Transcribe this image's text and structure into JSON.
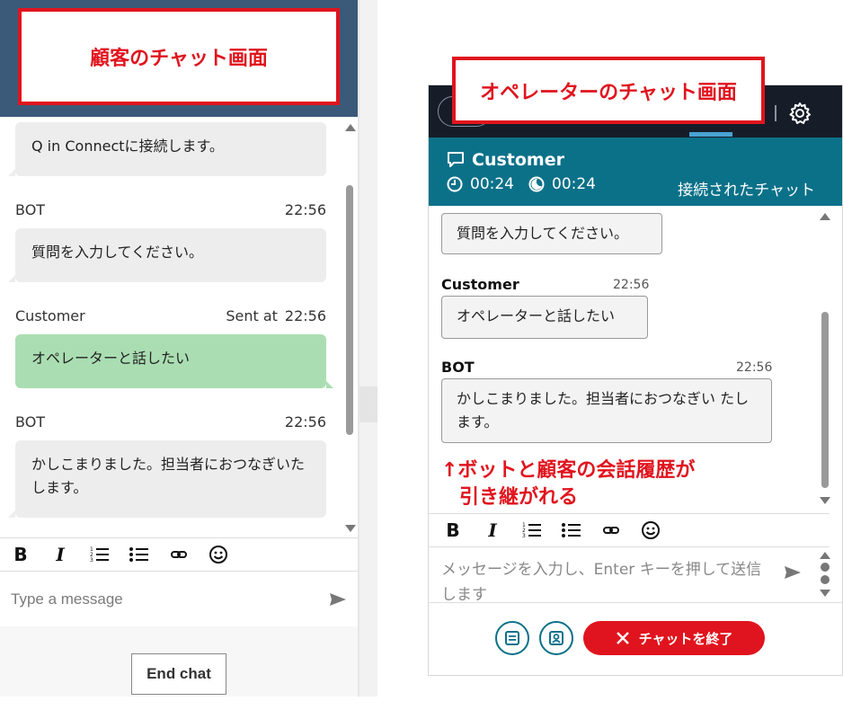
{
  "labels": {
    "customer_screen": "顧客のチャット画面",
    "operator_screen": "オペレーターのチャット画面",
    "annotation_line1": "↑ボットと顧客の会話履歴が",
    "annotation_line2": "引き継がれる"
  },
  "customer_chat": {
    "messages": [
      {
        "sender": "",
        "time": "",
        "text": "Q in Connectに接続します。",
        "style": "grey"
      },
      {
        "sender": "BOT",
        "time": "22:56",
        "text": "質問を入力してください。",
        "style": "grey"
      },
      {
        "sender": "Customer",
        "sent_at": "Sent at",
        "time": "22:56",
        "text": "オペレーターと話したい",
        "style": "green"
      },
      {
        "sender": "BOT",
        "time": "22:56",
        "text": "かしこまりました。担当者におつなぎいたします。",
        "style": "grey"
      }
    ],
    "toolbar": {
      "bold": "B",
      "italic": "I"
    },
    "input_placeholder": "Type a message",
    "end_chat": "End chat"
  },
  "operator_chat": {
    "contact_name": "Customer",
    "timer_1": "00:24",
    "timer_2": "00:24",
    "status": "接続されたチャット",
    "messages": [
      {
        "sender": "",
        "time": "",
        "text": "質問を入力してください。"
      },
      {
        "sender": "Customer",
        "time": "22:56",
        "text": "オペレーターと話したい"
      },
      {
        "sender": "BOT",
        "time": "22:56",
        "text": "かしこまりました。担当者におつなぎい たします。"
      }
    ],
    "toolbar": {
      "bold": "B",
      "italic": "I"
    },
    "input_placeholder": "メッセージを入力し、Enter キーを押して送信します",
    "end_chat": "チャットを終了"
  },
  "colors": {
    "accent_teal": "#0b7189",
    "alert_red": "#e0141e",
    "customer_bubble": "#aadeb2",
    "header_navy": "#3b5a79"
  }
}
